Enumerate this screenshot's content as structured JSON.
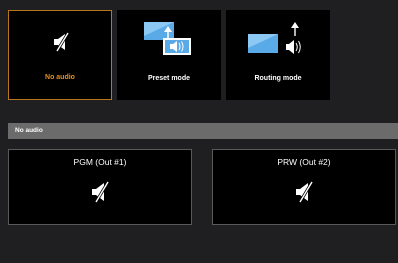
{
  "modes": [
    {
      "label": "No audio",
      "icon": "muted-speaker-icon",
      "selected": true
    },
    {
      "label": "Preset mode",
      "icon": "preset-mode-icon",
      "selected": false
    },
    {
      "label": "Routing mode",
      "icon": "routing-mode-icon",
      "selected": false
    }
  ],
  "section": {
    "title": "No audio"
  },
  "outputs": [
    {
      "title": "PGM (Out #1)",
      "icon": "muted-speaker-icon"
    },
    {
      "title": "PRW (Out #2)",
      "icon": "muted-speaker-icon"
    }
  ],
  "colors": {
    "background": "#1f1f21",
    "tile": "#000000",
    "selected_border": "#b8761e",
    "selected_text": "#e88e20",
    "section_bar": "#6c6b6b",
    "screen_blue": "#5aaae8"
  }
}
